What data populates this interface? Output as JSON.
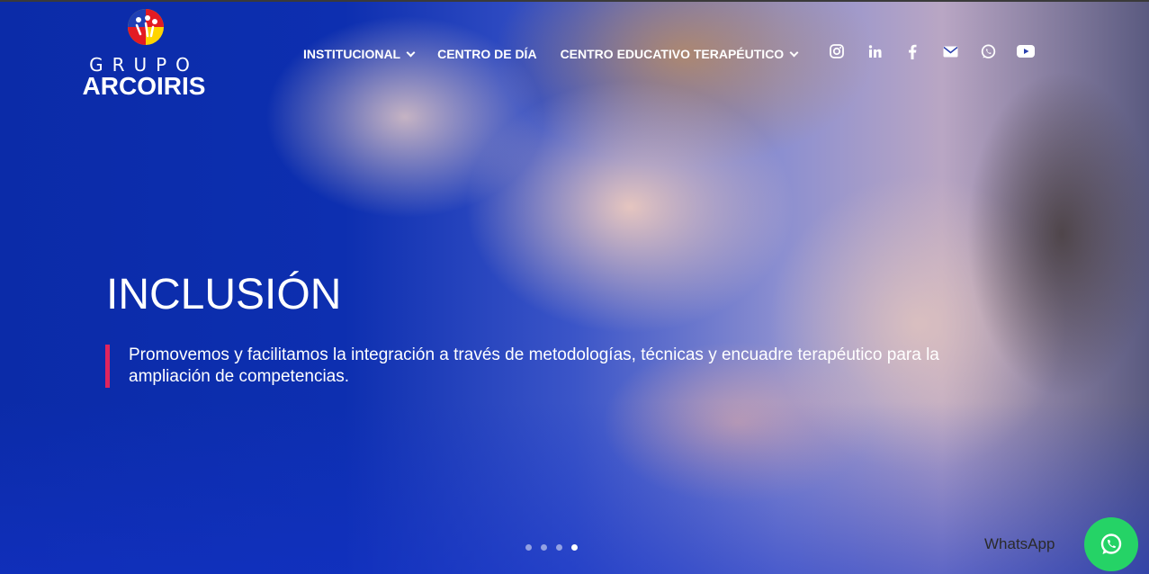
{
  "brand": {
    "line1": "GRUPO",
    "line2": "ARCOIRIS"
  },
  "nav": {
    "items": [
      {
        "label": "INSTITUCIONAL",
        "has_dropdown": true
      },
      {
        "label": "CENTRO DE DÍA",
        "has_dropdown": false
      },
      {
        "label": "CENTRO EDUCATIVO TERAPÉUTICO",
        "has_dropdown": true
      }
    ],
    "social": [
      "instagram-icon",
      "linkedin-icon",
      "facebook-icon",
      "email-icon",
      "whatsapp-icon",
      "youtube-icon"
    ]
  },
  "hero": {
    "title": "INCLUSIÓN",
    "text": "Promovemos y facilitamos la integración a través de metodologías, técnicas y encuadre terapéutico para la ampliación de competencias.",
    "slides_total": 4,
    "active_slide": 4
  },
  "whatsapp": {
    "label": "WhatsApp"
  },
  "colors": {
    "accent_bar": "#e0245e",
    "whatsapp": "#25d366",
    "hero_blue": "#0b2ba8"
  }
}
